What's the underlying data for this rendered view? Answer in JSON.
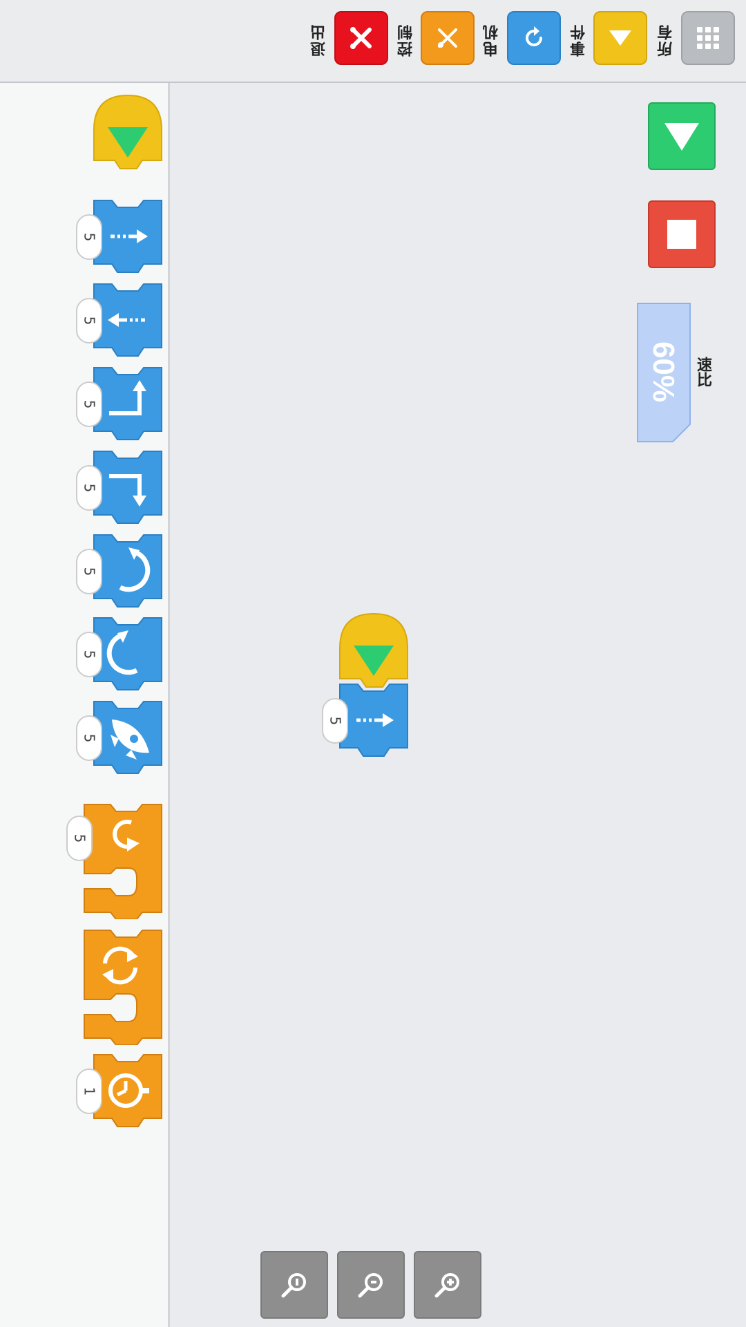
{
  "categories": [
    {
      "id": "exit",
      "label": "退出",
      "icon": "exit-icon",
      "color": "#e8121f"
    },
    {
      "id": "control",
      "label": "控制",
      "icon": "control-icon",
      "color": "#f3991b"
    },
    {
      "id": "motor",
      "label": "电机",
      "icon": "motor-icon",
      "color": "#3b9ae1"
    },
    {
      "id": "events",
      "label": "事件",
      "icon": "flag-icon",
      "color": "#f1c21a"
    },
    {
      "id": "all",
      "label": "所有",
      "icon": "grid-icon",
      "color": "#b9bcc0"
    }
  ],
  "palette": {
    "blocks": [
      {
        "name": "when-flag-clicked-block",
        "icon": "green-flag-icon"
      },
      {
        "name": "move-forward-block",
        "icon": "arrow-right-icon",
        "param": "5"
      },
      {
        "name": "move-backward-block",
        "icon": "arrow-left-icon",
        "param": "5"
      },
      {
        "name": "turn-left-block",
        "icon": "turn-left-icon",
        "param": "5"
      },
      {
        "name": "turn-right-block",
        "icon": "turn-right-icon",
        "param": "5"
      },
      {
        "name": "rotate-left-block",
        "icon": "rotate-ccw-icon",
        "param": "5"
      },
      {
        "name": "rotate-right-block",
        "icon": "rotate-cw-icon",
        "param": "5"
      },
      {
        "name": "rocket-block",
        "icon": "rocket-icon",
        "param": "5"
      },
      {
        "name": "repeat-block",
        "icon": "repeat-icon",
        "param": "5"
      },
      {
        "name": "forever-block",
        "icon": "forever-icon"
      },
      {
        "name": "wait-block",
        "icon": "stopwatch-icon",
        "param": "1"
      }
    ]
  },
  "workspace": {
    "script": {
      "hat_icon": "green-flag-icon",
      "move_block": {
        "icon": "arrow-right-icon",
        "param": "5"
      }
    },
    "speed": {
      "label": "速比",
      "value": "60%"
    },
    "run_icon": "play-icon",
    "stop_icon": "stop-icon"
  },
  "zoom": [
    {
      "id": "zoom-out",
      "icon": "zoom-out-icon"
    },
    {
      "id": "zoom-reset",
      "icon": "zoom-reset-icon"
    },
    {
      "id": "zoom-in",
      "icon": "zoom-in-icon"
    }
  ],
  "colors": {
    "motion": "#3b9ae1",
    "control": "#f39c1c",
    "event": "#f1c40f",
    "run": "#2ecc71",
    "stop": "#e74c3c",
    "speed_fill": "#bcd2f6"
  }
}
